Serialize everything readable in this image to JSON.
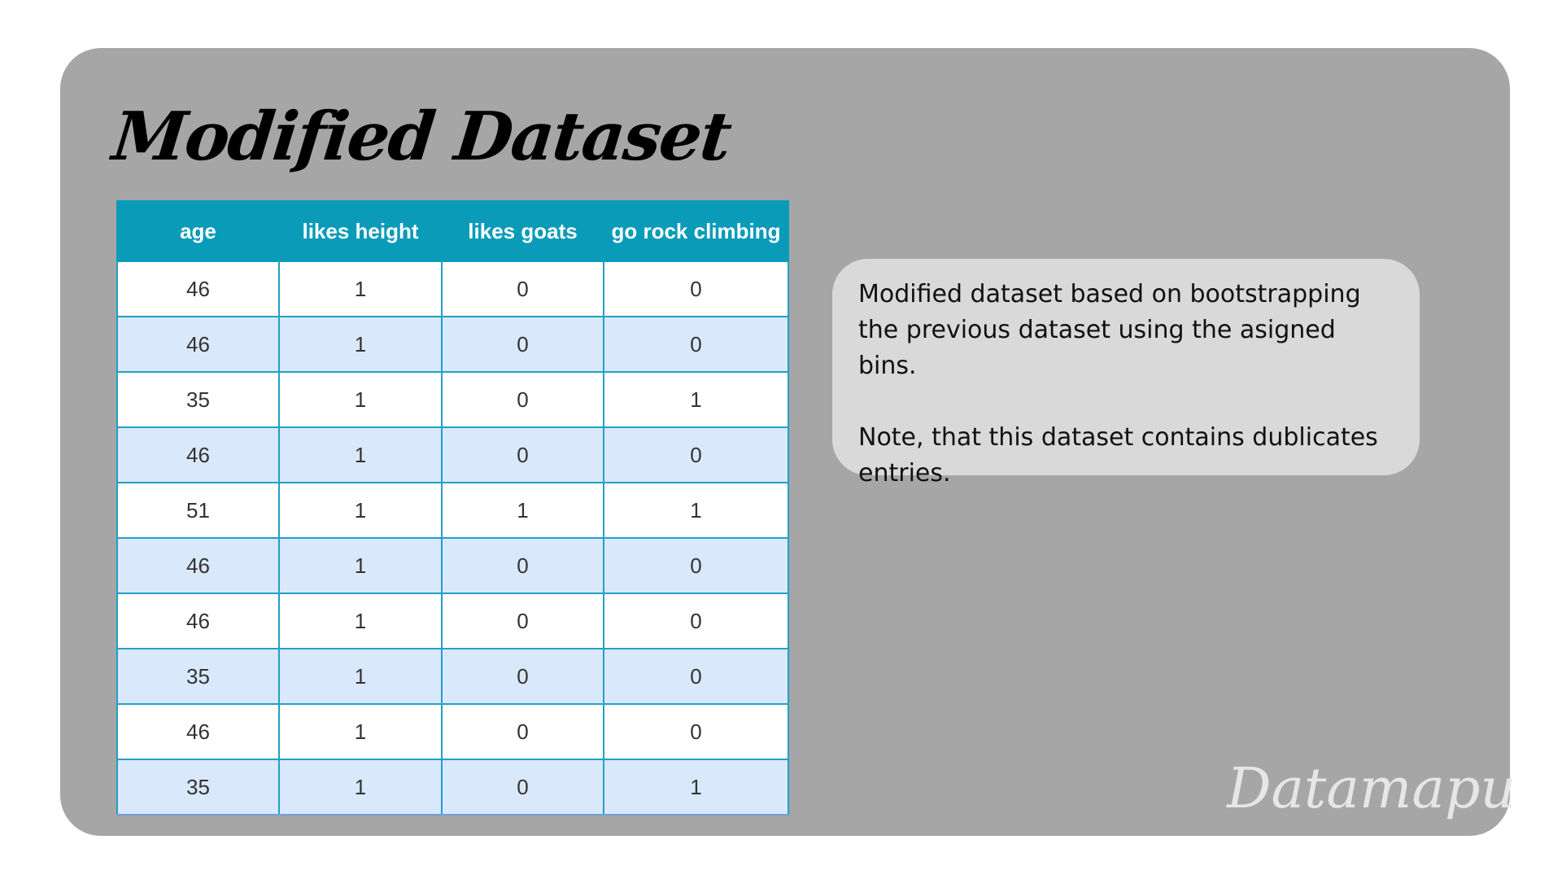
{
  "slide": {
    "title": "Modified Dataset",
    "watermark": "Datamapu"
  },
  "table": {
    "columns": [
      "age",
      "likes height",
      "likes goats",
      "go rock climbing"
    ],
    "rows": [
      [
        "46",
        "1",
        "0",
        "0"
      ],
      [
        "46",
        "1",
        "0",
        "0"
      ],
      [
        "35",
        "1",
        "0",
        "1"
      ],
      [
        "46",
        "1",
        "0",
        "0"
      ],
      [
        "51",
        "1",
        "1",
        "1"
      ],
      [
        "46",
        "1",
        "0",
        "0"
      ],
      [
        "46",
        "1",
        "0",
        "0"
      ],
      [
        "35",
        "1",
        "0",
        "0"
      ],
      [
        "46",
        "1",
        "0",
        "0"
      ],
      [
        "35",
        "1",
        "0",
        "1"
      ]
    ]
  },
  "note": {
    "paragraph1": "Modified dataset based on bootstrapping the previous dataset using the asigned bins.",
    "paragraph2": "Note, that this dataset contains dublicates entries."
  },
  "colors": {
    "background": "#a6a6a6",
    "header": "#0a9bb8",
    "row_alt": "#dae8fb",
    "note_box": "#d9d9d9"
  }
}
